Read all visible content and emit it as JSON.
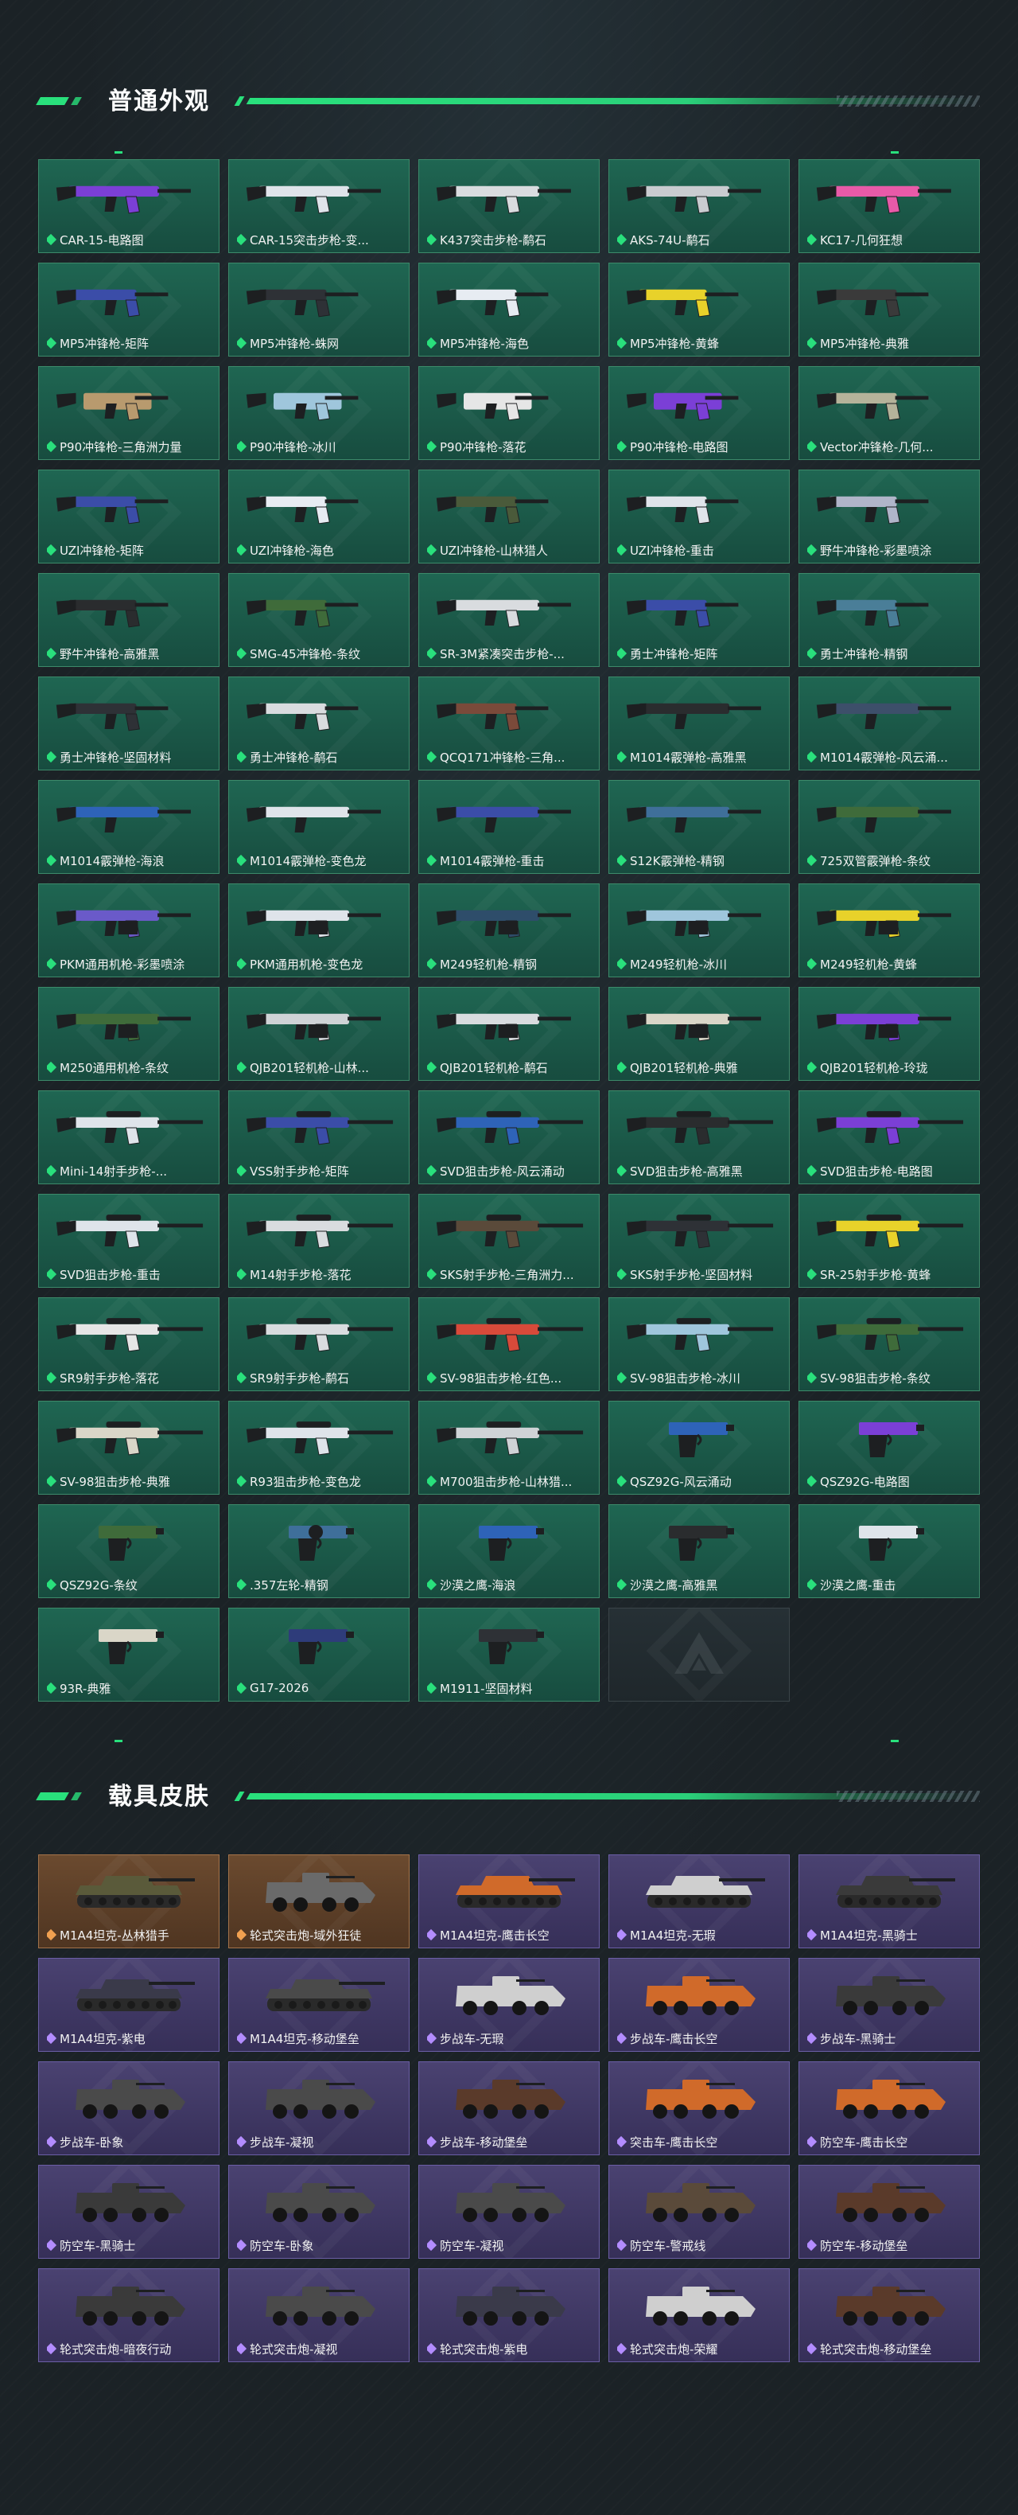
{
  "colors": {
    "accent": "#29e07c",
    "green_card": "#1f6652",
    "purple_card": "#4a4271",
    "orange_card": "#6b4a2f"
  },
  "sections": [
    {
      "title": "普通外观",
      "rarity": "green",
      "items": [
        {
          "label": "CAR-15-电路图",
          "color": "#7b3fd6",
          "kind": "rifle"
        },
        {
          "label": "CAR-15突击步枪-变...",
          "color": "#dfe4ea",
          "kind": "rifle"
        },
        {
          "label": "K437突击步枪-鹬石",
          "color": "#d9dcdf",
          "kind": "rifle"
        },
        {
          "label": "AKS-74U-鹬石",
          "color": "#c9ccd0",
          "kind": "rifle"
        },
        {
          "label": "KC17-几何狂想",
          "color": "#e85aa8",
          "kind": "rifle"
        },
        {
          "label": "MP5冲锋枪-矩阵",
          "color": "#3b4da8",
          "kind": "smg"
        },
        {
          "label": "MP5冲锋枪-蛛网",
          "color": "#2e3136",
          "kind": "smg"
        },
        {
          "label": "MP5冲锋枪-海色",
          "color": "#e7ecf2",
          "kind": "smg"
        },
        {
          "label": "MP5冲锋枪-黄蜂",
          "color": "#e8d22a",
          "kind": "smg"
        },
        {
          "label": "MP5冲锋枪-典雅",
          "color": "#3a3a3a",
          "kind": "smg"
        },
        {
          "label": "P90冲锋枪-三角洲力量",
          "color": "#b89a6e",
          "kind": "p90"
        },
        {
          "label": "P90冲锋枪-冰川",
          "color": "#9fc6dc",
          "kind": "p90"
        },
        {
          "label": "P90冲锋枪-落花",
          "color": "#e6e6e6",
          "kind": "p90"
        },
        {
          "label": "P90冲锋枪-电路图",
          "color": "#7b3fd6",
          "kind": "p90"
        },
        {
          "label": "Vector冲锋枪-几何...",
          "color": "#b5b39a",
          "kind": "smg"
        },
        {
          "label": "UZI冲锋枪-矩阵",
          "color": "#3b4da8",
          "kind": "smg"
        },
        {
          "label": "UZI冲锋枪-海色",
          "color": "#e7ecf2",
          "kind": "smg"
        },
        {
          "label": "UZI冲锋枪-山林猎人",
          "color": "#4a5a3a",
          "kind": "smg"
        },
        {
          "label": "UZI冲锋枪-重击",
          "color": "#dfe4ea",
          "kind": "smg"
        },
        {
          "label": "野牛冲锋枪-彩墨喷涂",
          "color": "#b0b5c9",
          "kind": "smg"
        },
        {
          "label": "野牛冲锋枪-高雅黑",
          "color": "#2a2c2e",
          "kind": "smg"
        },
        {
          "label": "SMG-45冲锋枪-条纹",
          "color": "#3f6b3a",
          "kind": "smg"
        },
        {
          "label": "SR-3M紧凑突击步枪-...",
          "color": "#d9dcdf",
          "kind": "rifle"
        },
        {
          "label": "勇士冲锋枪-矩阵",
          "color": "#3b4da8",
          "kind": "smg"
        },
        {
          "label": "勇士冲锋枪-精钢",
          "color": "#4a7e98",
          "kind": "smg"
        },
        {
          "label": "勇士冲锋枪-坚固材料",
          "color": "#2e3136",
          "kind": "smg"
        },
        {
          "label": "勇士冲锋枪-鹬石",
          "color": "#d9dcdf",
          "kind": "smg"
        },
        {
          "label": "QCQ171冲锋枪-三角...",
          "color": "#7a4a3a",
          "kind": "smg"
        },
        {
          "label": "M1014霰弹枪-高雅黑",
          "color": "#2a2c2e",
          "kind": "shotgun"
        },
        {
          "label": "M1014霰弹枪-风云涌...",
          "color": "#3d4f6a",
          "kind": "shotgun"
        },
        {
          "label": "M1014霰弹枪-海浪",
          "color": "#2e63b8",
          "kind": "shotgun"
        },
        {
          "label": "M1014霰弹枪-变色龙",
          "color": "#dfe4ea",
          "kind": "shotgun"
        },
        {
          "label": "M1014霰弹枪-重击",
          "color": "#3b4da8",
          "kind": "shotgun"
        },
        {
          "label": "S12K霰弹枪-精钢",
          "color": "#3f6f9a",
          "kind": "shotgun"
        },
        {
          "label": "725双管霰弹枪-条纹",
          "color": "#3f6b3a",
          "kind": "shotgun"
        },
        {
          "label": "PKM通用机枪-彩墨喷涂",
          "color": "#6a5ac9",
          "kind": "mg"
        },
        {
          "label": "PKM通用机枪-变色龙",
          "color": "#dfe4ea",
          "kind": "mg"
        },
        {
          "label": "M249轻机枪-精钢",
          "color": "#2e4d6a",
          "kind": "mg"
        },
        {
          "label": "M249轻机枪-冰川",
          "color": "#9fc6dc",
          "kind": "mg"
        },
        {
          "label": "M249轻机枪-黄蜂",
          "color": "#e8d22a",
          "kind": "mg"
        },
        {
          "label": "M250通用机枪-条纹",
          "color": "#3f6b3a",
          "kind": "mg"
        },
        {
          "label": "QJB201轻机枪-山林...",
          "color": "#cfd3d6",
          "kind": "mg"
        },
        {
          "label": "QJB201轻机枪-鹬石",
          "color": "#d9dcdf",
          "kind": "mg"
        },
        {
          "label": "QJB201轻机枪-典雅",
          "color": "#dad6c8",
          "kind": "mg"
        },
        {
          "label": "QJB201轻机枪-玲珑",
          "color": "#7b3fd6",
          "kind": "mg"
        },
        {
          "label": "Mini-14射手步枪-...",
          "color": "#dfe4ea",
          "kind": "sniper"
        },
        {
          "label": "VSS射手步枪-矩阵",
          "color": "#3b4da8",
          "kind": "sniper"
        },
        {
          "label": "SVD狙击步枪-风云涌动",
          "color": "#2e63b8",
          "kind": "sniper"
        },
        {
          "label": "SVD狙击步枪-高雅黑",
          "color": "#2a2c2e",
          "kind": "sniper"
        },
        {
          "label": "SVD狙击步枪-电路图",
          "color": "#7b3fd6",
          "kind": "sniper"
        },
        {
          "label": "SVD狙击步枪-重击",
          "color": "#dfe4ea",
          "kind": "sniper"
        },
        {
          "label": "M14射手步枪-落花",
          "color": "#d9dcdf",
          "kind": "sniper"
        },
        {
          "label": "SKS射手步枪-三角洲力...",
          "color": "#5a4a3a",
          "kind": "sniper"
        },
        {
          "label": "SKS射手步枪-坚固材料",
          "color": "#2e3136",
          "kind": "sniper"
        },
        {
          "label": "SR-25射手步枪-黄蜂",
          "color": "#e8d22a",
          "kind": "sniper"
        },
        {
          "label": "SR9射手步枪-落花",
          "color": "#e6e6e6",
          "kind": "sniper"
        },
        {
          "label": "SR9射手步枪-鹬石",
          "color": "#d9dcdf",
          "kind": "sniper"
        },
        {
          "label": "SV-98狙击步枪-红色...",
          "color": "#d84a3a",
          "kind": "sniper"
        },
        {
          "label": "SV-98狙击步枪-冰川",
          "color": "#9fc6dc",
          "kind": "sniper"
        },
        {
          "label": "SV-98狙击步枪-条纹",
          "color": "#3f6b3a",
          "kind": "sniper"
        },
        {
          "label": "SV-98狙击步枪-典雅",
          "color": "#dad6c8",
          "kind": "sniper"
        },
        {
          "label": "R93狙击步枪-变色龙",
          "color": "#dfe4ea",
          "kind": "sniper"
        },
        {
          "label": "M700狙击步枪-山林猎...",
          "color": "#cfd3d6",
          "kind": "sniper"
        },
        {
          "label": "QSZ92G-风云涌动",
          "color": "#2e63b8",
          "kind": "pistol"
        },
        {
          "label": "QSZ92G-电路图",
          "color": "#7b3fd6",
          "kind": "pistol"
        },
        {
          "label": "QSZ92G-条纹",
          "color": "#3f6b3a",
          "kind": "pistol"
        },
        {
          "label": ".357左轮-精钢",
          "color": "#3f6f9a",
          "kind": "revolver"
        },
        {
          "label": "沙漠之鹰-海浪",
          "color": "#2e63b8",
          "kind": "pistol"
        },
        {
          "label": "沙漠之鹰-高雅黑",
          "color": "#2a2c2e",
          "kind": "pistol"
        },
        {
          "label": "沙漠之鹰-重击",
          "color": "#dfe4ea",
          "kind": "pistol"
        },
        {
          "label": "93R-典雅",
          "color": "#dad6c8",
          "kind": "pistol"
        },
        {
          "label": "G17-2026",
          "color": "#2e3c7a",
          "kind": "pistol"
        },
        {
          "label": "M1911-坚固材料",
          "color": "#2e3136",
          "kind": "pistol"
        },
        {
          "label": "",
          "color": "",
          "kind": "empty"
        }
      ]
    },
    {
      "title": "载具皮肤",
      "rarity": "purple",
      "items": [
        {
          "label": "M1A4坦克-丛林猎手",
          "color": "#5a5a3a",
          "kind": "tank",
          "tier": "orange"
        },
        {
          "label": "轮式突击炮-域外狂徒",
          "color": "#6a6a6a",
          "kind": "apc",
          "tier": "orange"
        },
        {
          "label": "M1A4坦克-鹰击长空",
          "color": "#d06a2a",
          "kind": "tank",
          "tier": "purple"
        },
        {
          "label": "M1A4坦克-无瑕",
          "color": "#cfcfcf",
          "kind": "tank",
          "tier": "purple"
        },
        {
          "label": "M1A4坦克-黑骑士",
          "color": "#3a3a3a",
          "kind": "tank",
          "tier": "purple"
        },
        {
          "label": "M1A4坦克-紫电",
          "color": "#3a3a4a",
          "kind": "tank",
          "tier": "purple"
        },
        {
          "label": "M1A4坦克-移动堡垒",
          "color": "#4a4a4a",
          "kind": "tank",
          "tier": "purple"
        },
        {
          "label": "步战车-无瑕",
          "color": "#cfcfcf",
          "kind": "apc",
          "tier": "purple"
        },
        {
          "label": "步战车-鹰击长空",
          "color": "#d06a2a",
          "kind": "apc",
          "tier": "purple"
        },
        {
          "label": "步战车-黑骑士",
          "color": "#3a3a3a",
          "kind": "apc",
          "tier": "purple"
        },
        {
          "label": "步战车-卧象",
          "color": "#4a4a4a",
          "kind": "apc",
          "tier": "purple"
        },
        {
          "label": "步战车-凝视",
          "color": "#4a4a4a",
          "kind": "apc",
          "tier": "purple"
        },
        {
          "label": "步战车-移动堡垒",
          "color": "#5a3a2a",
          "kind": "apc",
          "tier": "purple"
        },
        {
          "label": "突击车-鹰击长空",
          "color": "#d06a2a",
          "kind": "apc",
          "tier": "purple"
        },
        {
          "label": "防空车-鹰击长空",
          "color": "#d06a2a",
          "kind": "apc",
          "tier": "purple"
        },
        {
          "label": "防空车-黑骑士",
          "color": "#3a3a3a",
          "kind": "apc",
          "tier": "purple"
        },
        {
          "label": "防空车-卧象",
          "color": "#4a4a4a",
          "kind": "apc",
          "tier": "purple"
        },
        {
          "label": "防空车-凝视",
          "color": "#4a4a4a",
          "kind": "apc",
          "tier": "purple"
        },
        {
          "label": "防空车-警戒线",
          "color": "#5a4a3a",
          "kind": "apc",
          "tier": "purple"
        },
        {
          "label": "防空车-移动堡垒",
          "color": "#5a3a2a",
          "kind": "apc",
          "tier": "purple"
        },
        {
          "label": "轮式突击炮-暗夜行动",
          "color": "#3a3a3a",
          "kind": "apc",
          "tier": "purple"
        },
        {
          "label": "轮式突击炮-凝视",
          "color": "#4a4a4a",
          "kind": "apc",
          "tier": "purple"
        },
        {
          "label": "轮式突击炮-紫电",
          "color": "#3a3a4a",
          "kind": "apc",
          "tier": "purple"
        },
        {
          "label": "轮式突击炮-荣耀",
          "color": "#cfcfcf",
          "kind": "apc",
          "tier": "purple"
        },
        {
          "label": "轮式突击炮-移动堡垒",
          "color": "#5a3a2a",
          "kind": "apc",
          "tier": "purple"
        }
      ]
    }
  ]
}
